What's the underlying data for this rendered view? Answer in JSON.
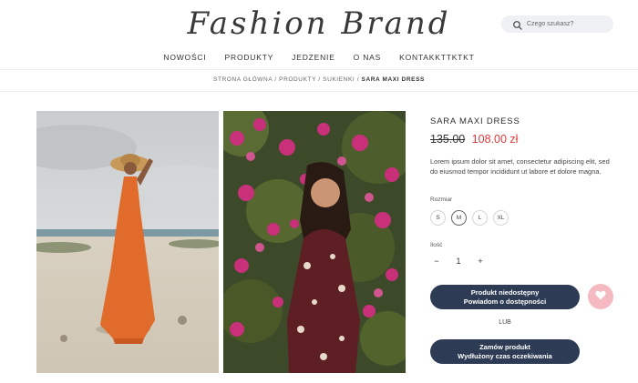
{
  "header": {
    "logo_text": "Fashion Brand",
    "search_placeholder": "Czego szukasz?"
  },
  "nav": {
    "items": [
      "NOWOŚCI",
      "PRODUKTY",
      "JEDZENIE",
      "O NAS",
      "KONTAKKTTKTKT"
    ]
  },
  "breadcrumb": {
    "path": "STRONA GŁÓWNA / PRODUKTY / SUKIENKI /",
    "current": "SARA MAXI DRESS"
  },
  "product": {
    "title": "SARA MAXI DRESS",
    "old_price": "135.00",
    "new_price": "108.00 zł",
    "description": "Lorem ipsum dolor sit amet, consectetur adipiscing elit, sed do eiusmod tempor incididunt ut labore et dolore magna.",
    "size_label": "Rozmiar",
    "sizes": [
      "S",
      "M",
      "L",
      "XL"
    ],
    "selected_size": "M",
    "qty_label": "Ilość",
    "qty_minus": "−",
    "qty_value": "1",
    "qty_plus": "+",
    "notify_line1": "Produkt niedostępny",
    "notify_line2": "Powiadom o dostępności",
    "or_text": "LUB",
    "order_line1": "Zamów produkt",
    "order_line2": "Wydłużony czas oczekiwania"
  },
  "colors": {
    "button_bg": "#2d3b55",
    "price_red": "#e03a3a",
    "heart_bg": "#f4b9c1"
  },
  "icons": {
    "search": "search-icon",
    "wishlist": "heart-icon"
  }
}
